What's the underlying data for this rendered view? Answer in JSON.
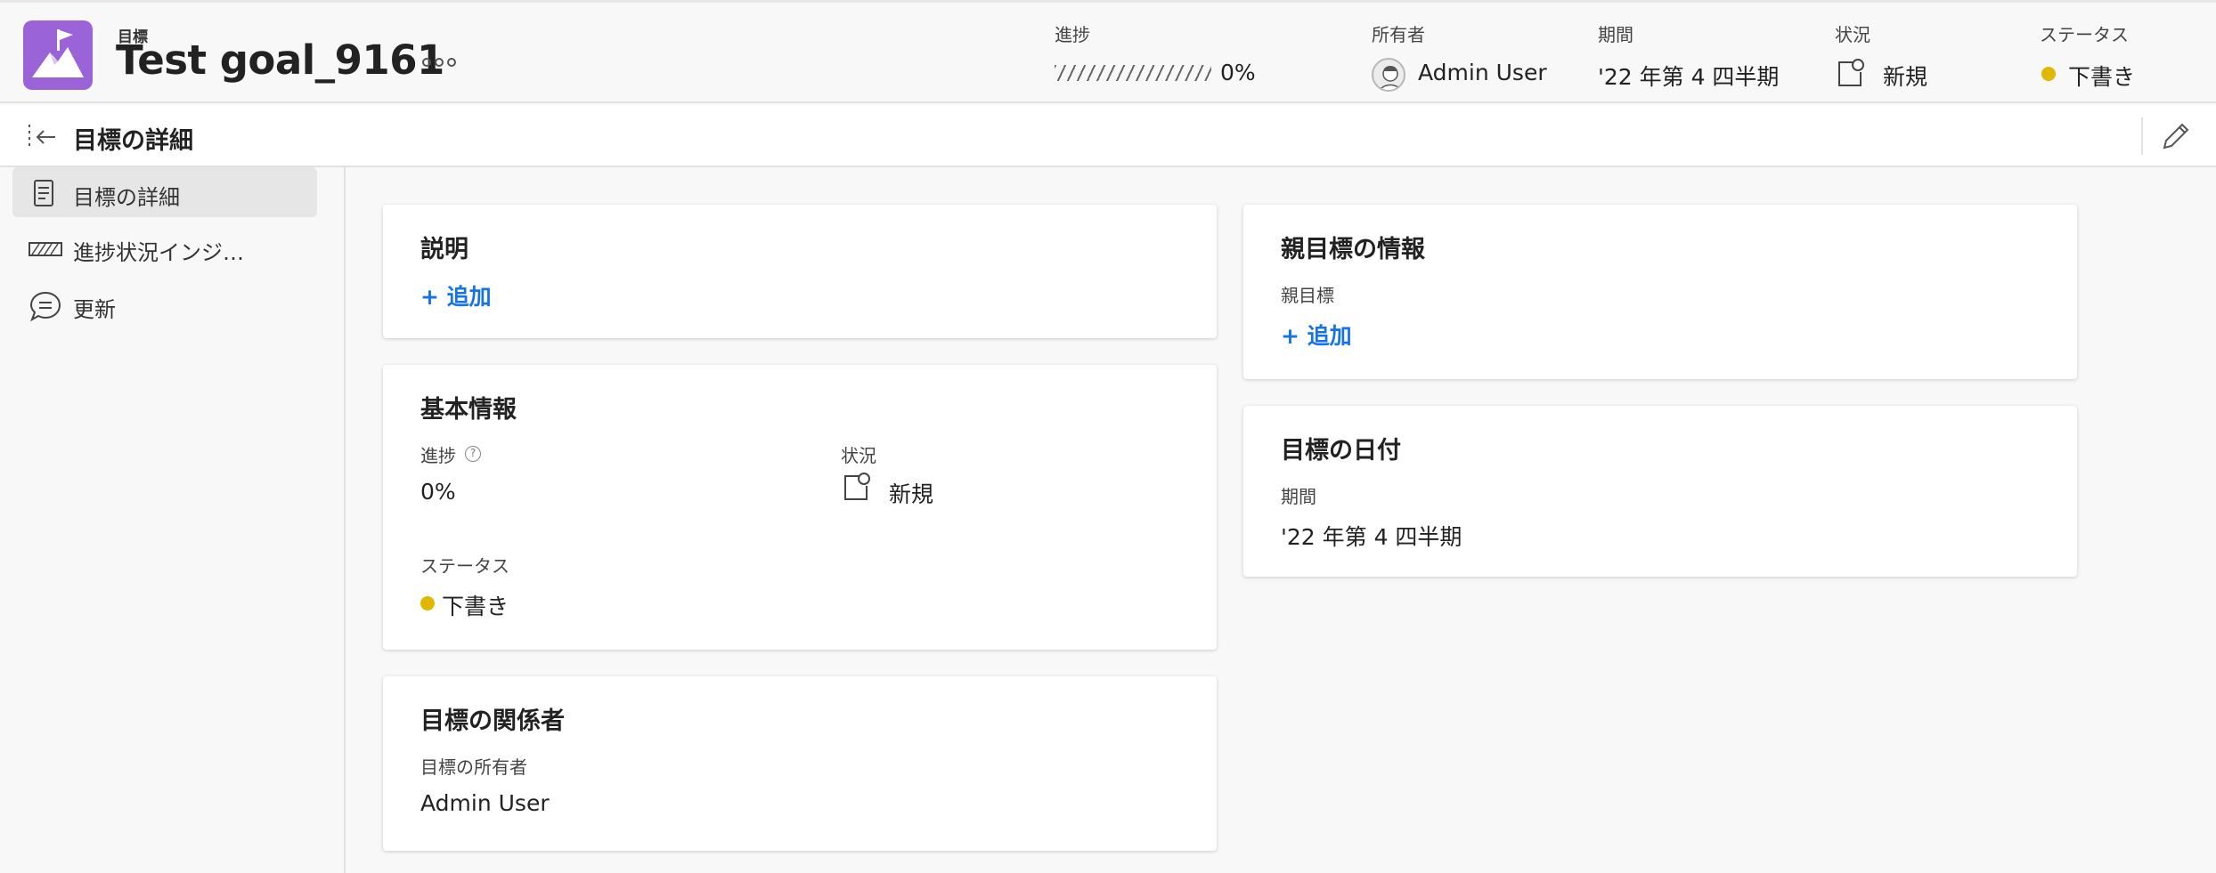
{
  "header": {
    "object_kind": "目標",
    "title": "Test goal_9161",
    "more_label": "∘∘∘",
    "progress": {
      "label": "進捗",
      "value": "0%"
    },
    "owner": {
      "label": "所有者",
      "value": "Admin User"
    },
    "period": {
      "label": "期間",
      "value": "'22 年第 4 四半期"
    },
    "condition": {
      "label": "状況",
      "value": "新規"
    },
    "status": {
      "label": "ステータス",
      "value": "下書き",
      "color": "#e0b800"
    }
  },
  "subheader": {
    "title": "目標の詳細",
    "collapse_icon": "collapse-panel-icon",
    "edit_icon": "pencil-icon"
  },
  "sidebar": {
    "items": [
      {
        "label": "目標の詳細",
        "icon": "document-icon",
        "active": true
      },
      {
        "label": "進捗状況インジ…",
        "icon": "progress-stripes-icon",
        "active": false
      },
      {
        "label": "更新",
        "icon": "chat-bubble-icon",
        "active": false
      }
    ]
  },
  "cards": {
    "description": {
      "title": "説明",
      "add_label": "+ 追加"
    },
    "basic_info": {
      "title": "基本情報",
      "progress_label": "進捗",
      "progress_help": "?",
      "progress_value": "0%",
      "condition_label": "状況",
      "condition_value": "新規",
      "status_label": "ステータス",
      "status_value": "下書き"
    },
    "stakeholders": {
      "title": "目標の関係者",
      "owner_label": "目標の所有者",
      "owner_value": "Admin User"
    },
    "parent": {
      "title": "親目標の情報",
      "parent_label": "親目標",
      "add_label": "+ 追加"
    },
    "dates": {
      "title": "目標の日付",
      "period_label": "期間",
      "period_value": "'22 年第 4 四半期"
    }
  },
  "colors": {
    "brand": "#9b63d8",
    "link": "#1473e6",
    "draft": "#e0b800"
  }
}
